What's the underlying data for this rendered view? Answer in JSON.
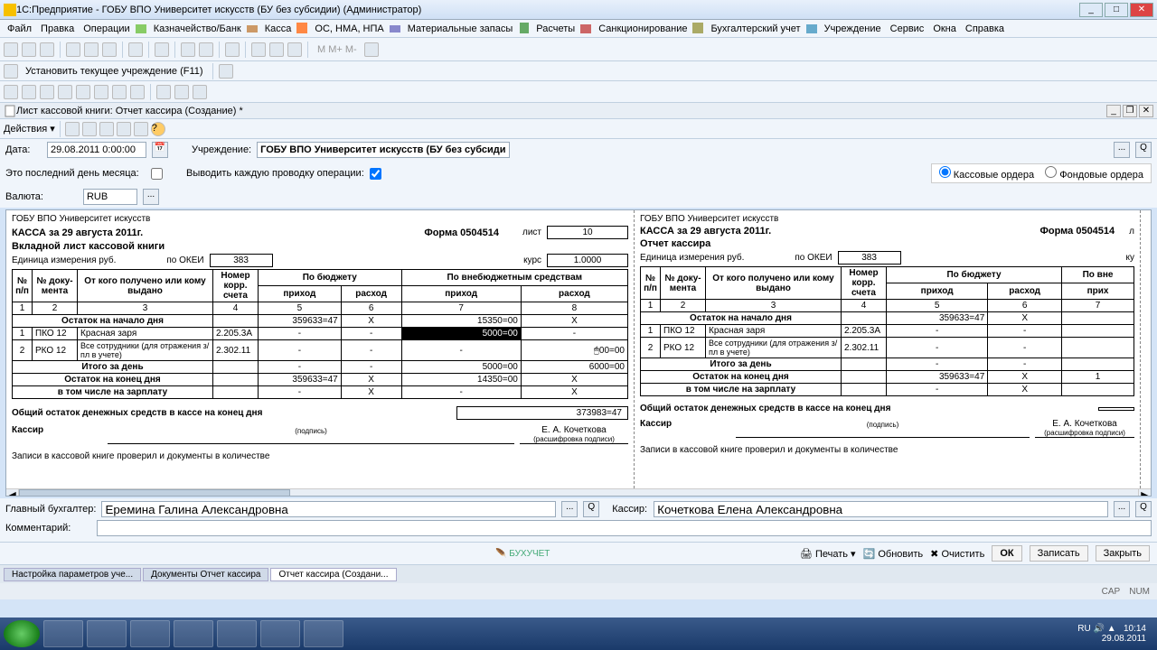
{
  "window": {
    "title": "1С:Предприятие - ГОБУ ВПО Университет искусств (БУ без субсидии) (Администратор)"
  },
  "menu": [
    "Файл",
    "Правка",
    "Операции",
    "Казначейство/Банк",
    "Касса",
    "ОС, НМА, НПА",
    "Материальные запасы",
    "Расчеты",
    "Санкционирование",
    "Бухгалтерский учет",
    "Учреждение",
    "Сервис",
    "Окна",
    "Справка"
  ],
  "toolbar1": {
    "set_institution": "Установить текущее учреждение (F11)"
  },
  "doc": {
    "title": "Лист кассовой книги: Отчет кассира (Создание) *",
    "actions_label": "Действия"
  },
  "form": {
    "date_label": "Дата:",
    "date_value": "29.08.2011 0:00:00",
    "last_day_label": "Это последний день месяца:",
    "currency_label": "Валюта:",
    "currency_value": "RUB",
    "institution_label": "Учреждение:",
    "institution_value": "ГОБУ ВПО Университет искусств (БУ без субсидии)",
    "show_each_label": "Выводить каждую проводку операции:",
    "radio_cash": "Кассовые ордера",
    "radio_fund": "Фондовые ордера"
  },
  "report": {
    "org": "ГОБУ ВПО Университет искусств",
    "cash_title": "КАССА за 29 августа 2011г.",
    "subtitle": "Вкладной лист кассовой книги",
    "subtitle_right": "Отчет кассира",
    "unit": "Единица измерения  руб.",
    "okei_label": "по ОКЕИ",
    "okei_value": "383",
    "form_label": "Форма 0504514",
    "sheet_label": "лист",
    "sheet_value": "10",
    "rate_label": "курс",
    "rate_value": "1.0000",
    "headers": {
      "np": "№ п/п",
      "doc_no": "№ доку-мента",
      "from": "От кого получено или кому выдано",
      "corr": "Номер корр. счета",
      "budget": "По бюджету",
      "offbudget": "По внебюджетным средствам",
      "income": "приход",
      "expense": "расход"
    },
    "col_nums": [
      "1",
      "2",
      "3",
      "4",
      "5",
      "6",
      "7",
      "8"
    ],
    "rows": {
      "start": "Остаток на начало дня",
      "r1_doc": "ПКО 12",
      "r1_from": "Красная заря",
      "r1_corr": "2.205.3A",
      "r1_off_in": "5000=00",
      "r2_doc": "РКО 12",
      "r2_from": "Все сотрудники (для отражения з/пл в учете)",
      "r2_corr": "2.302.11",
      "r2_off_out_cursor": "00=00",
      "day_total": "Итого за день",
      "end": "Остаток на конец дня",
      "salary": "в том числе на зарплату",
      "start_budget": "359633=47",
      "start_off": "15350=00",
      "total_off_in": "5000=00",
      "total_off_out": "6000=00",
      "end_budget": "359633=47",
      "end_off": "14350=00"
    },
    "total_label": "Общий остаток денежных средств в кассе на конец дня",
    "total_value": "373983=47",
    "cashier_label": "Кассир",
    "signature_sub1": "(подпись)",
    "signature_sub2": "(расшифровка подписи)",
    "cashier_name": "Е. А. Кочеткова",
    "verify_text": "Записи в кассовой книге проверил и документы в количестве",
    "dash": "-",
    "x": "X"
  },
  "bottom": {
    "chief_label": "Главный бухгалтер:",
    "chief_value": "Еремина Галина Александровна",
    "cashier_label": "Кассир:",
    "cashier_value": "Кочеткова Елена Александровна",
    "comment_label": "Комментарий:",
    "comment_value": "",
    "logo": "БУХУЧЕТ",
    "print": "Печать",
    "refresh": "Обновить",
    "clear": "Очистить",
    "ok": "ОК",
    "save": "Записать",
    "close": "Закрыть"
  },
  "tabs": [
    "Настройка параметров уче...",
    "Документы Отчет кассира",
    "Отчет кассира (Создани..."
  ],
  "status": {
    "cap": "CAP",
    "num": "NUM"
  },
  "taskbar": {
    "lang": "RU",
    "time": "10:14",
    "date": "29.08.2011"
  }
}
